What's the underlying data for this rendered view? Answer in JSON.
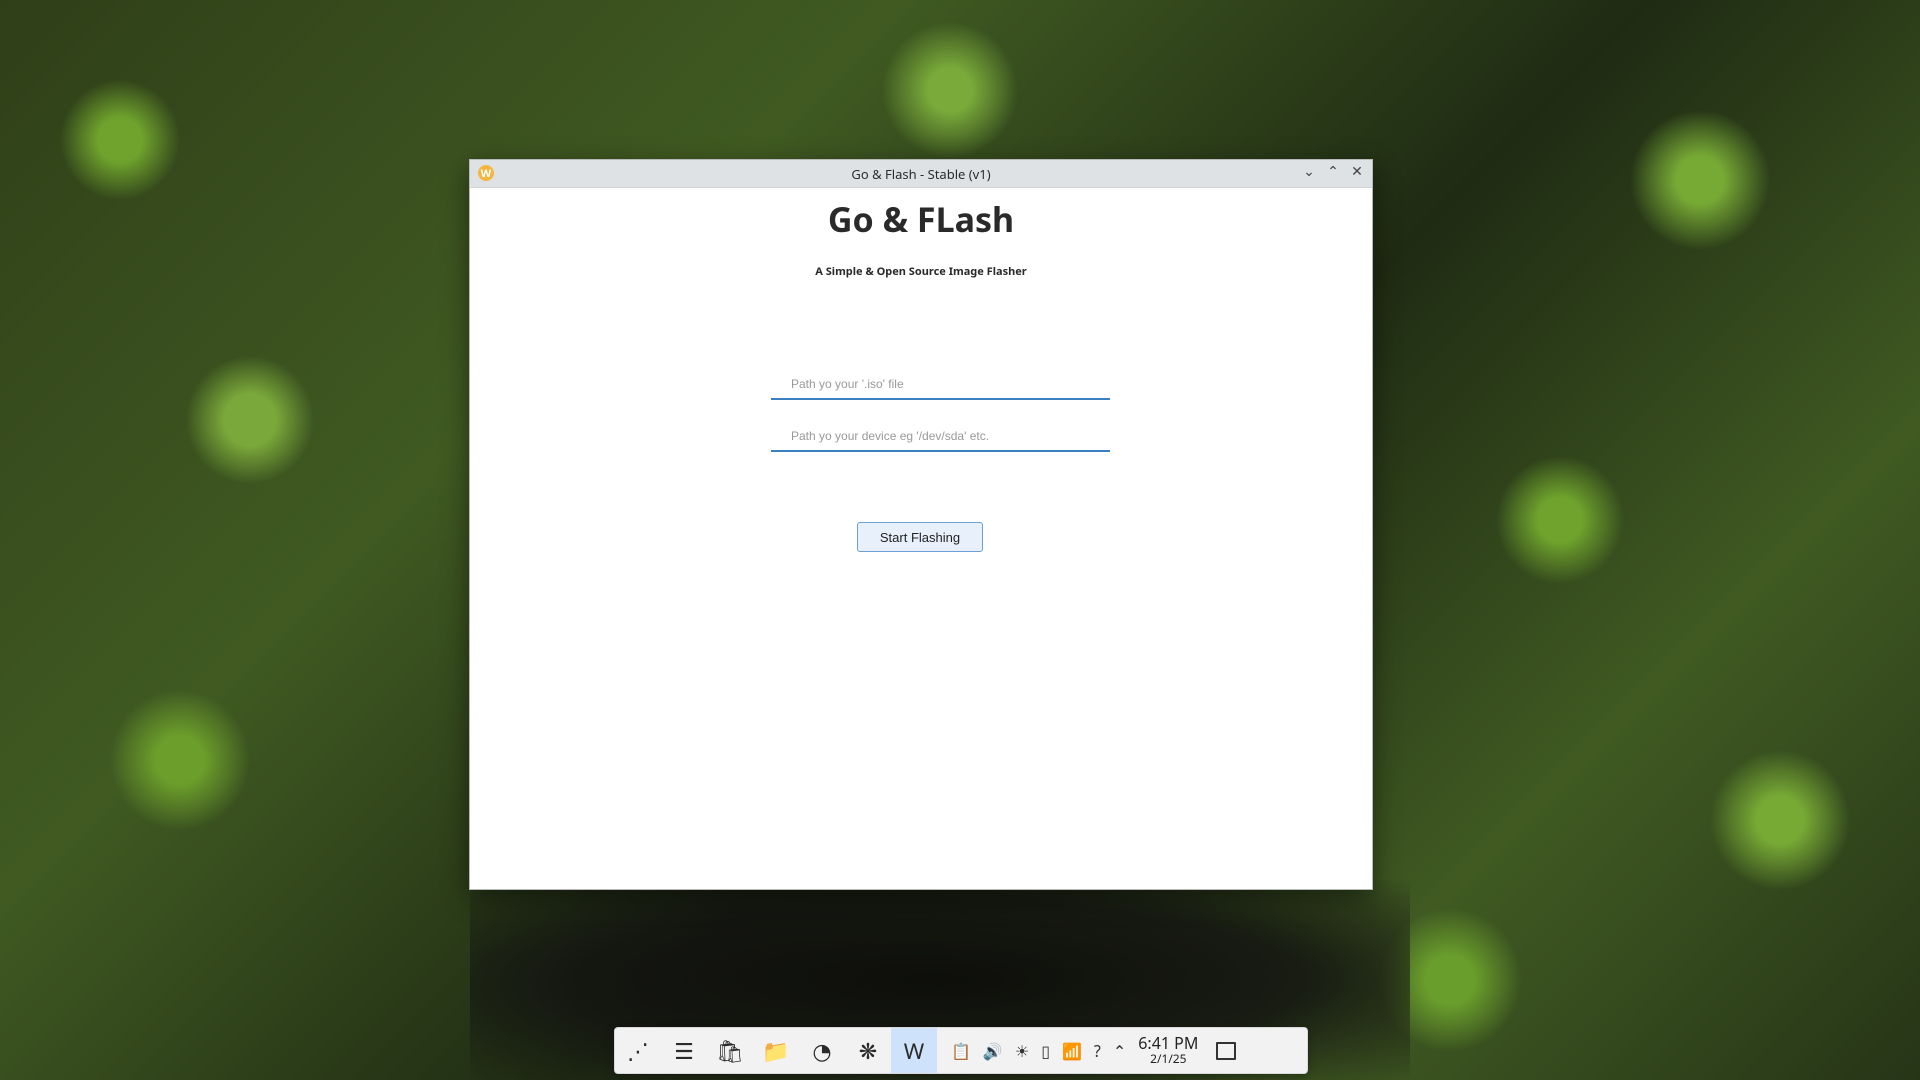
{
  "window": {
    "title": "Go & Flash - Stable (v1)",
    "app_icon": "W",
    "controls": {
      "minimize": "⌄",
      "maximize": "⌃",
      "close": "✕"
    }
  },
  "app": {
    "heading": "Go & FLash",
    "subheading": "A Simple & Open Source Image Flasher",
    "iso_placeholder": "Path yo your '.iso' file",
    "device_placeholder": "Path yo your device eg '/dev/sda' etc.",
    "start_button": "Start Flashing"
  },
  "taskbar": {
    "apps": [
      {
        "name": "application-launcher",
        "glyph": "⋰"
      },
      {
        "name": "settings-app",
        "glyph": "☰"
      },
      {
        "name": "store-app",
        "glyph": "🛍"
      },
      {
        "name": "file-manager-app",
        "glyph": "📁"
      },
      {
        "name": "browser-app",
        "glyph": "◔"
      },
      {
        "name": "discover-app",
        "glyph": "❋"
      },
      {
        "name": "go-flash-app",
        "glyph": "W"
      }
    ],
    "tray": [
      {
        "name": "clipboard-icon",
        "glyph": "📋"
      },
      {
        "name": "volume-icon",
        "glyph": "🔊"
      },
      {
        "name": "brightness-icon",
        "glyph": "☀"
      },
      {
        "name": "battery-icon",
        "glyph": "▯"
      },
      {
        "name": "wifi-icon",
        "glyph": "📶"
      },
      {
        "name": "help-icon",
        "glyph": "?"
      },
      {
        "name": "chevron-up-icon",
        "glyph": "⌃"
      }
    ],
    "time": "6:41 PM",
    "date": "2/1/25"
  }
}
